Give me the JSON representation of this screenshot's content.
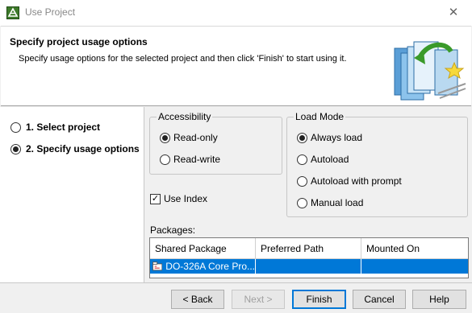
{
  "window": {
    "title": "Use Project",
    "close_symbol": "✕"
  },
  "header": {
    "title": "Specify project usage options",
    "description": "Specify usage options for the selected project and then click 'Finish' to start using it."
  },
  "steps": [
    {
      "label": "1. Select project",
      "selected": false
    },
    {
      "label": "2. Specify usage options",
      "selected": true
    }
  ],
  "accessibility": {
    "legend": "Accessibility",
    "options": [
      {
        "label": "Read-only",
        "selected": true
      },
      {
        "label": "Read-write",
        "selected": false
      }
    ]
  },
  "load_mode": {
    "legend": "Load Mode",
    "options": [
      {
        "label": "Always load",
        "selected": true
      },
      {
        "label": "Autoload",
        "selected": false
      },
      {
        "label": "Autoload with prompt",
        "selected": false
      },
      {
        "label": "Manual load",
        "selected": false
      }
    ]
  },
  "use_index": {
    "label": "Use Index",
    "checked": true,
    "check_symbol": "✓"
  },
  "packages": {
    "label": "Packages:",
    "columns": [
      "Shared Package",
      "Preferred Path",
      "Mounted On"
    ],
    "rows": [
      {
        "shared_package": "DO-326A Core Pro...",
        "preferred_path": "",
        "mounted_on": "",
        "icon": "package-icon"
      }
    ]
  },
  "buttons": {
    "back": "< Back",
    "next": "Next >",
    "finish": "Finish",
    "cancel": "Cancel",
    "help": "Help"
  },
  "colors": {
    "selection": "#0078d7",
    "default_button_border": "#0078d7"
  }
}
